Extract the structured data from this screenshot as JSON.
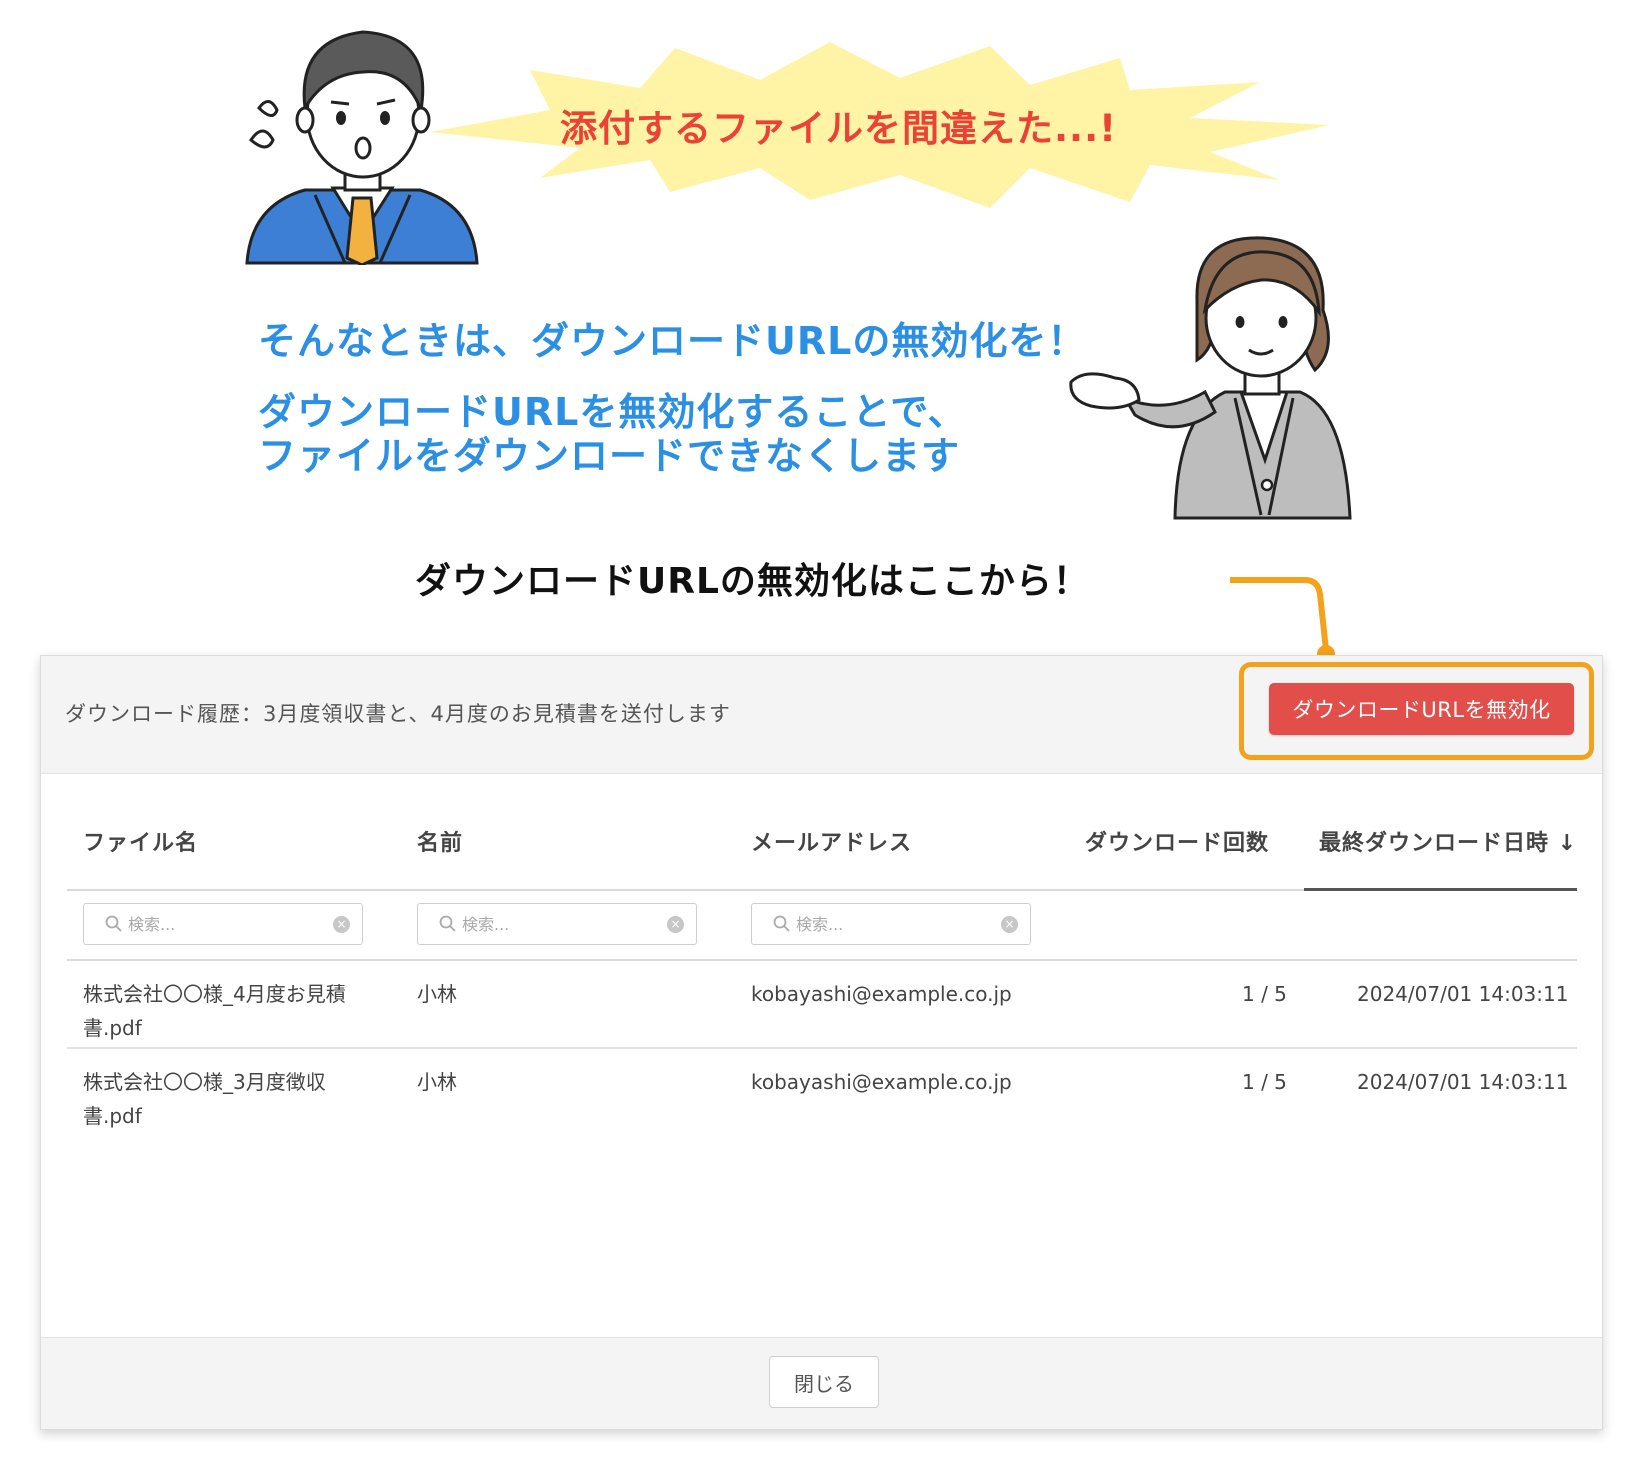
{
  "illustration": {
    "burst_text": "添付するファイルを間違えた...!",
    "message_line1": "そんなときは、ダウンロードURLの無効化を！",
    "message_line2a": "ダウンロードURLを無効化することで、",
    "message_line2b": "ファイルをダウンロードできなくします",
    "callout": "ダウンロードURLの無効化はここから！"
  },
  "dialog": {
    "title": "ダウンロード履歴：3月度領収書と、4月度のお見積書を送付します",
    "disable_button_label": "ダウンロードURLを無効化",
    "columns": [
      "ファイル名",
      "名前",
      "メールアドレス",
      "ダウンロード回数",
      "最終ダウンロード日時 ↓"
    ],
    "search_placeholder": "検索...",
    "rows": [
      {
        "file": "株式会社〇〇様_4月度お見積書.pdf",
        "name": "小林",
        "email": "kobayashi@example.co.jp",
        "count": "1 / 5",
        "last_download": "2024/07/01 14:03:11"
      },
      {
        "file": "株式会社〇〇様_3月度徴収書.pdf",
        "name": "小林",
        "email": "kobayashi@example.co.jp",
        "count": "1 / 5",
        "last_download": "2024/07/01 14:03:11"
      }
    ],
    "close_button_label": "閉じる"
  },
  "colors": {
    "accent_red": "#e24e4a",
    "highlight_orange": "#f4a11b",
    "message_blue": "#2b8fe3",
    "burst_yellow": "#fff3a6",
    "burst_text_red": "#ea4335"
  }
}
